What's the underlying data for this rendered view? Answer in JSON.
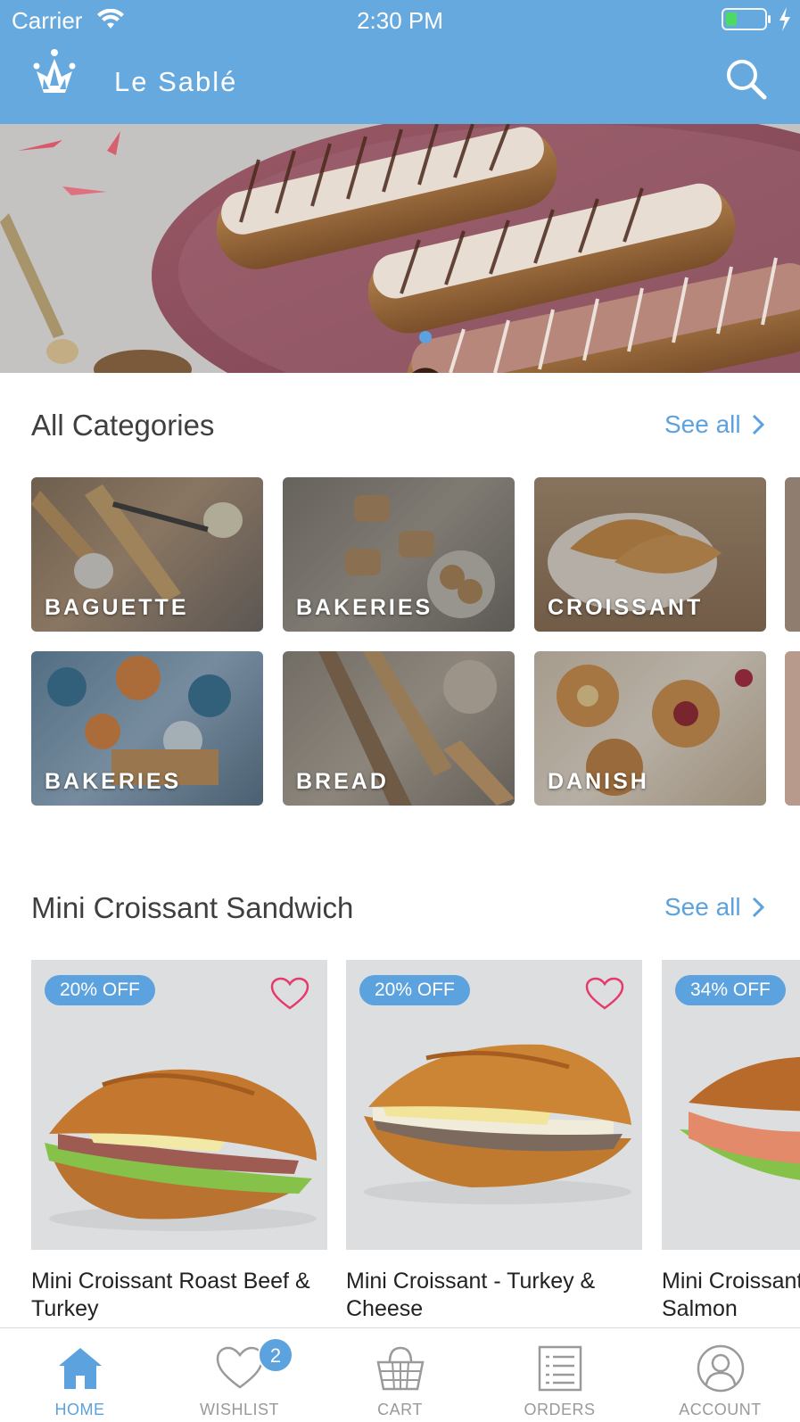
{
  "status_bar": {
    "carrier": "Carrier",
    "time": "2:30 PM"
  },
  "header": {
    "brand": "Le Sablé"
  },
  "hero": {
    "slides": 3,
    "active_slide": 3
  },
  "categories": {
    "title": "All Categories",
    "see_all": "See all",
    "items": [
      {
        "label": "BAGUETTE"
      },
      {
        "label": "BAKERIES"
      },
      {
        "label": "CROISSANT"
      },
      {
        "label": "BAKERIES"
      },
      {
        "label": "BREAD"
      },
      {
        "label": "DANISH"
      }
    ]
  },
  "products": {
    "title": "Mini Croissant Sandwich",
    "see_all": "See all",
    "items": [
      {
        "badge": "20% OFF",
        "name": "Mini Croissant Roast Beef & Turkey"
      },
      {
        "badge": "20% OFF",
        "name": "Mini Croissant - Turkey & Cheese"
      },
      {
        "badge": "34% OFF",
        "name": "Mini Croissant Smoked Salmon"
      }
    ]
  },
  "tabbar": {
    "home": "HOME",
    "wishlist": "WISHLIST",
    "wishlist_count": "2",
    "cart": "CART",
    "orders": "ORDERS",
    "account": "ACCOUNT"
  },
  "colors": {
    "accent": "#5ba2de",
    "header": "#66a9df",
    "heart": "#e53a6b"
  }
}
